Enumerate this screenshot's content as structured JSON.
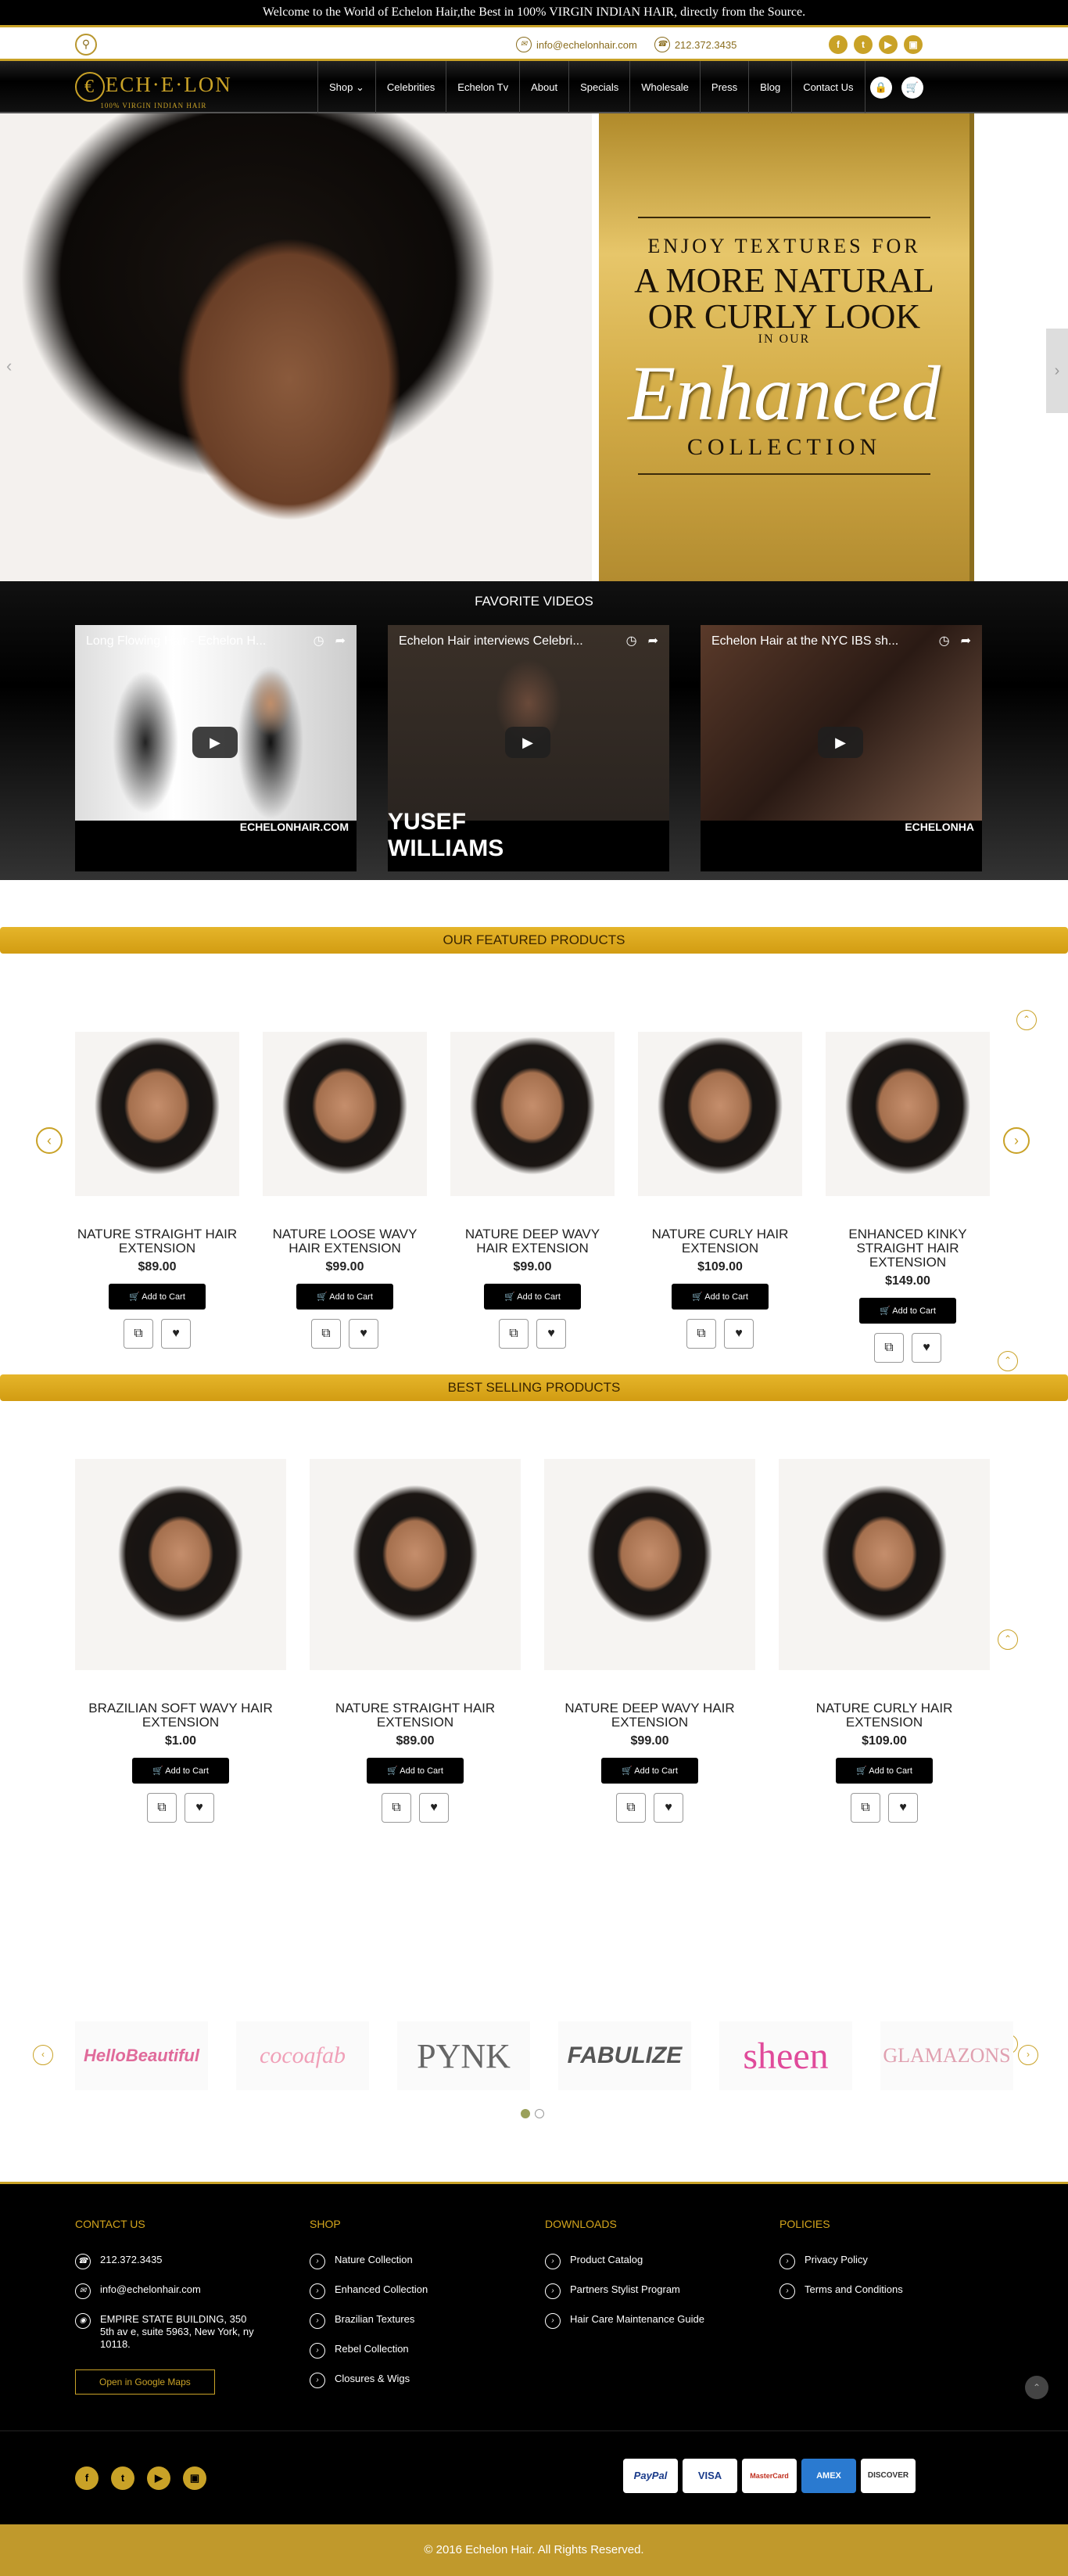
{
  "topbar": {
    "welcome": "Welcome to the World of Echelon Hair,the Best in 100% VIRGIN INDIAN HAIR, directly from the Source."
  },
  "contact": {
    "email": "info@echelonhair.com",
    "phone": "212.372.3435"
  },
  "logo": {
    "name": "ECH·E·LON",
    "tagline": "100% VIRGIN INDIAN HAIR"
  },
  "nav": {
    "items": [
      "Shop ⌄",
      "Celebrities",
      "Echelon Tv",
      "About",
      "Specials",
      "Wholesale",
      "Press",
      "Blog",
      "Contact Us"
    ]
  },
  "hero": {
    "line1": "ENJOY TEXTURES FOR",
    "line2": "A MORE NATURAL",
    "line3": "OR CURLY LOOK",
    "line4": "IN OUR",
    "line5": "Enhanced",
    "line6": "COLLECTION"
  },
  "videos": {
    "heading": "FAVORITE VIDEOS",
    "items": [
      {
        "title": "Long Flowing Hair - Echelon H...",
        "brand": "ECHELONHAIR.COM"
      },
      {
        "title": "Echelon Hair interviews Celebri...",
        "brand": "YUSEF WILLIAMS"
      },
      {
        "title": "Echelon Hair at the NYC IBS sh...",
        "brand": "ECHELONHA"
      }
    ]
  },
  "featured": {
    "heading": "OUR FEATURED PRODUCTS",
    "add_label": "Add to Cart",
    "items": [
      {
        "name": "NATURE STRAIGHT HAIR EXTENSION",
        "price": "$89.00"
      },
      {
        "name": "NATURE LOOSE WAVY HAIR EXTENSION",
        "price": "$99.00"
      },
      {
        "name": "NATURE DEEP WAVY HAIR EXTENSION",
        "price": "$99.00"
      },
      {
        "name": "NATURE CURLY HAIR EXTENSION",
        "price": "$109.00"
      },
      {
        "name": "ENHANCED KINKY STRAIGHT HAIR EXTENSION",
        "price": "$149.00"
      }
    ]
  },
  "bestselling": {
    "heading": "BEST SELLING PRODUCTS",
    "add_label": "Add to Cart",
    "items": [
      {
        "name": "BRAZILIAN SOFT WAVY HAIR EXTENSION",
        "price": "$1.00"
      },
      {
        "name": "NATURE STRAIGHT HAIR EXTENSION",
        "price": "$89.00"
      },
      {
        "name": "NATURE DEEP WAVY HAIR EXTENSION",
        "price": "$99.00"
      },
      {
        "name": "NATURE CURLY HAIR EXTENSION",
        "price": "$109.00"
      }
    ]
  },
  "brands": [
    "HelloBeautiful",
    "cocoafab",
    "PYNK",
    "FABULIZE",
    "sheen",
    "GLAMAZONS"
  ],
  "footer": {
    "contact": {
      "title": "CONTACT US",
      "phone": "212.372.3435",
      "email": "info@echelonhair.com",
      "address": "EMPIRE STATE BUILDING, 350 5th av e, suite 5963, New York, ny 10118.",
      "map_btn": "Open in Google Maps"
    },
    "shop": {
      "title": "SHOP",
      "items": [
        "Nature Collection",
        "Enhanced Collection",
        "Brazilian Textures",
        "Rebel Collection",
        "Closures & Wigs"
      ]
    },
    "downloads": {
      "title": "DOWNLOADS",
      "items": [
        "Product Catalog",
        "Partners Stylist Program",
        "Hair Care Maintenance Guide"
      ]
    },
    "policies": {
      "title": "POLICIES",
      "items": [
        "Privacy Policy",
        "Terms and Conditions"
      ]
    },
    "payments": [
      "PayPal",
      "VISA",
      "MasterCard",
      "AMEX",
      "DISCOVER"
    ],
    "copyright": "© 2016 Echelon Hair. All Rights Reserved."
  },
  "colors": {
    "gold": "#c9a227",
    "black": "#000000"
  }
}
